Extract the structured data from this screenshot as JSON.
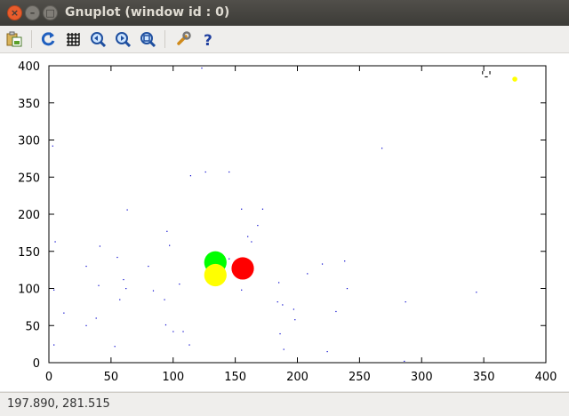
{
  "window": {
    "title": "Gnuplot (window id : 0)"
  },
  "toolbar": {
    "buttons": [
      {
        "name": "copy-to-clipboard-button",
        "icon": "clipboard-icon"
      },
      {
        "name": "replot-button",
        "icon": "refresh-icon"
      },
      {
        "name": "toggle-grid-button",
        "icon": "grid-icon"
      },
      {
        "name": "previous-zoom-button",
        "icon": "zoom-previous-icon"
      },
      {
        "name": "next-zoom-button",
        "icon": "zoom-next-icon"
      },
      {
        "name": "autoscale-button",
        "icon": "zoom-autoscale-icon"
      },
      {
        "name": "settings-button",
        "icon": "wrench-icon"
      },
      {
        "name": "help-button",
        "icon": "help-icon"
      }
    ]
  },
  "status": {
    "coordinates": "197.890,  281.515"
  },
  "chart_data": {
    "type": "scatter",
    "xlim": [
      0,
      400
    ],
    "ylim": [
      0,
      400
    ],
    "x_ticks": [
      "0",
      "50",
      "100",
      "150",
      "200",
      "250",
      "300",
      "350",
      "400"
    ],
    "y_ticks": [
      "0",
      "50",
      "100",
      "150",
      "200",
      "250",
      "300",
      "350",
      "400"
    ],
    "grid": false,
    "legend_sample": "'-'",
    "markers": [
      {
        "x": 134,
        "y": 135,
        "r": 9,
        "color": "#00ff00"
      },
      {
        "x": 134,
        "y": 118,
        "r": 9,
        "color": "#ffff00"
      },
      {
        "x": 156,
        "y": 127,
        "r": 9,
        "color": "#ff0000"
      },
      {
        "x": 375,
        "y": 382,
        "r": 2,
        "color": "#ffff00"
      }
    ],
    "dots_color": "#0000cc",
    "dots": [
      [
        123,
        397
      ],
      [
        3,
        292
      ],
      [
        268,
        289
      ],
      [
        145,
        257
      ],
      [
        126,
        257
      ],
      [
        114,
        252
      ],
      [
        63,
        206
      ],
      [
        155,
        207
      ],
      [
        172,
        207
      ],
      [
        5,
        163
      ],
      [
        160,
        170
      ],
      [
        163,
        163
      ],
      [
        95,
        177
      ],
      [
        41,
        157
      ],
      [
        97,
        158
      ],
      [
        55,
        142
      ],
      [
        30,
        130
      ],
      [
        80,
        130
      ],
      [
        150,
        125
      ],
      [
        220,
        133
      ],
      [
        238,
        137
      ],
      [
        40,
        104
      ],
      [
        60,
        112
      ],
      [
        105,
        106
      ],
      [
        185,
        108
      ],
      [
        155,
        98
      ],
      [
        62,
        100
      ],
      [
        240,
        100
      ],
      [
        4,
        98
      ],
      [
        93,
        85
      ],
      [
        57,
        85
      ],
      [
        84,
        97
      ],
      [
        208,
        120
      ],
      [
        184,
        82
      ],
      [
        188,
        78
      ],
      [
        197,
        72
      ],
      [
        198,
        58
      ],
      [
        231,
        69
      ],
      [
        12,
        67
      ],
      [
        38,
        60
      ],
      [
        30,
        50
      ],
      [
        94,
        51
      ],
      [
        100,
        42
      ],
      [
        108,
        42
      ],
      [
        186,
        39
      ],
      [
        287,
        82
      ],
      [
        344,
        95
      ],
      [
        113,
        24
      ],
      [
        53,
        22
      ],
      [
        4,
        24
      ],
      [
        189,
        18
      ],
      [
        224,
        15
      ],
      [
        286,
        2
      ],
      [
        168,
        185
      ],
      [
        145,
        140
      ]
    ]
  }
}
